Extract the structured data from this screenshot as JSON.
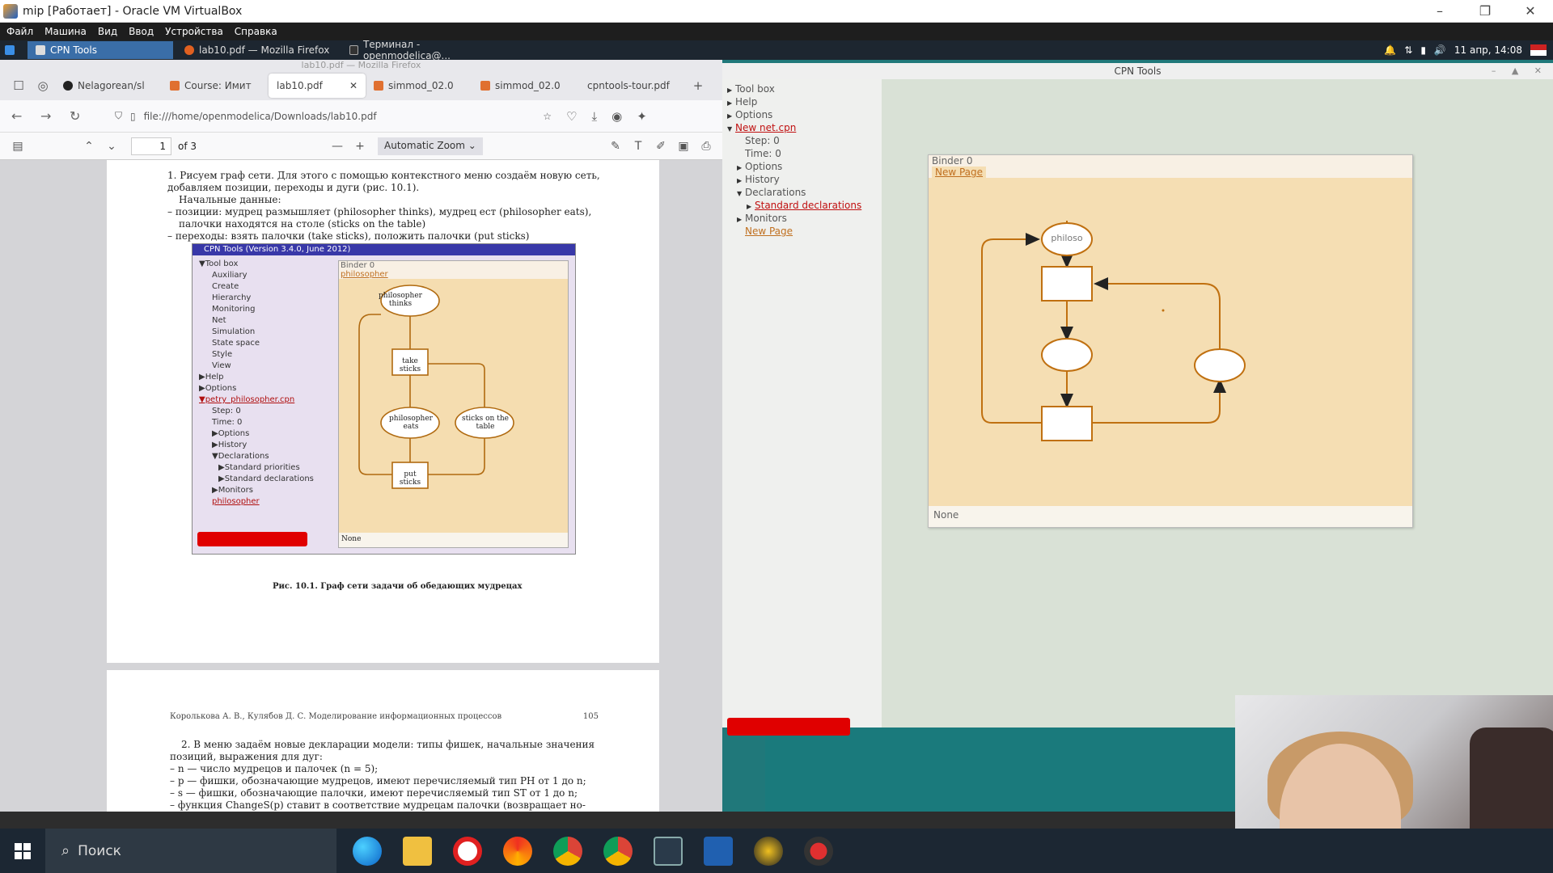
{
  "vbox": {
    "title": "mip [Работает] - Oracle VM VirtualBox",
    "menu": [
      "Файл",
      "Машина",
      "Вид",
      "Ввод",
      "Устройства",
      "Справка"
    ]
  },
  "guest_panel": {
    "tasks": [
      "CPN Tools",
      "lab10.pdf — Mozilla Firefox",
      "Терминал - openmodelica@..."
    ],
    "clock": "11 апр, 14:08"
  },
  "firefox": {
    "window_title": "lab10.pdf — Mozilla Firefox",
    "tabs": [
      "Nelagorean/sl",
      "Course: Имит",
      "lab10.pdf",
      "simmod_02.0",
      "simmod_02.0",
      "cpntools-tour.pdf"
    ],
    "url": "file:///home/openmodelica/Downloads/lab10.pdf",
    "pdf_page": "1",
    "pdf_total": "of 3",
    "zoom": "Automatic Zoom"
  },
  "pdf": {
    "page1_lines": [
      "1. Рисуем граф сети. Для этого с помощью контекстного меню создаём новую сеть,",
      "добавляем позиции, переходы и дуги (рис. 10.1).",
      "Начальные данные:",
      "– позиции: мудрец размышляет (philosopher thinks), мудрец ест (philosopher eats),",
      "палочки находятся на столе (sticks on the table)",
      "– переходы: взять палочки (take sticks), положить палочки (put sticks)"
    ],
    "caption": "Рис. 10.1. Граф сети задачи об обедающих мудрецах",
    "page2_header": "Королькова А. В., Кулябов Д. С. Моделирование информационных процессов",
    "page2_number": "105",
    "page2_lines": [
      "2. В меню задаём новые декларации модели: типы фишек, начальные значения",
      "позиций, выражения для дуг:",
      "– n — число мудрецов и палочек (n = 5);",
      "– p — фишки, обозначающие мудрецов, имеют перечисляемый тип PH от 1 до n;",
      "– s — фишки, обозначающие палочки, имеют перечисляемый тип ST от 1 до n;",
      "– функция ChangeS(p) ставит в соответствие мудрецам палочки (возвращает но-"
    ],
    "figure": {
      "title": "CPN Tools (Version 3.4.0, June 2012)",
      "tree": [
        {
          "t": "▼Tool box",
          "lvl": 0
        },
        {
          "t": "Auxiliary",
          "lvl": 1
        },
        {
          "t": "Create",
          "lvl": 1
        },
        {
          "t": "Hierarchy",
          "lvl": 1
        },
        {
          "t": "Monitoring",
          "lvl": 1
        },
        {
          "t": "Net",
          "lvl": 1
        },
        {
          "t": "Simulation",
          "lvl": 1
        },
        {
          "t": "State space",
          "lvl": 1
        },
        {
          "t": "Style",
          "lvl": 1
        },
        {
          "t": "View",
          "lvl": 1
        },
        {
          "t": "▶Help",
          "lvl": 0
        },
        {
          "t": "▶Options",
          "lvl": 0
        },
        {
          "t": "▼petry_philosopher.cpn",
          "lvl": 0,
          "link": true
        },
        {
          "t": "Step: 0",
          "lvl": 1
        },
        {
          "t": "Time: 0",
          "lvl": 1
        },
        {
          "t": "▶Options",
          "lvl": 1
        },
        {
          "t": "▶History",
          "lvl": 1
        },
        {
          "t": "▼Declarations",
          "lvl": 1
        },
        {
          "t": "▶Standard priorities",
          "lvl": 2
        },
        {
          "t": "▶Standard declarations",
          "lvl": 2
        },
        {
          "t": "▶Monitors",
          "lvl": 1
        },
        {
          "t": "philosopher",
          "lvl": 1,
          "link": true
        }
      ],
      "binder": "Binder 0",
      "tab": "philosopher",
      "footer": "None",
      "places": [
        "philosopher thinks",
        "philosopher eats",
        "sticks on the table"
      ],
      "transitions": [
        "take sticks",
        "put sticks"
      ]
    }
  },
  "cpn": {
    "window_title": "CPN Tools",
    "tree": [
      {
        "t": "Tool box",
        "tri": "▶",
        "indent": 0
      },
      {
        "t": "Help",
        "tri": "▶",
        "indent": 0
      },
      {
        "t": "Options",
        "tri": "▶",
        "indent": 0
      },
      {
        "t": "New net.cpn",
        "tri": "▼",
        "indent": 0,
        "link": true
      },
      {
        "t": "Step: 0",
        "tri": "",
        "indent": 22
      },
      {
        "t": "Time: 0",
        "tri": "",
        "indent": 22
      },
      {
        "t": "Options",
        "tri": "▶",
        "indent": 12
      },
      {
        "t": "History",
        "tri": "▶",
        "indent": 12
      },
      {
        "t": "Declarations",
        "tri": "▼",
        "indent": 12
      },
      {
        "t": "Standard declarations",
        "tri": "▶",
        "indent": 24,
        "link": true
      },
      {
        "t": "Monitors",
        "tri": "▶",
        "indent": 12
      },
      {
        "t": "New Page",
        "tri": "",
        "indent": 22,
        "link": true
      }
    ],
    "binder": "Binder 0",
    "page_tab": "New Page",
    "place_label": "philoso",
    "footer": "None"
  },
  "taskbar": {
    "search": "Поиск",
    "apps": [
      "edge-icon",
      "explorer-icon",
      "yandex-icon",
      "yandex-browser-icon",
      "chrome-icon",
      "chrome-profile-icon",
      "virtualbox-box-icon",
      "virtualbox-icon",
      "app-icon",
      "app2-icon"
    ]
  }
}
